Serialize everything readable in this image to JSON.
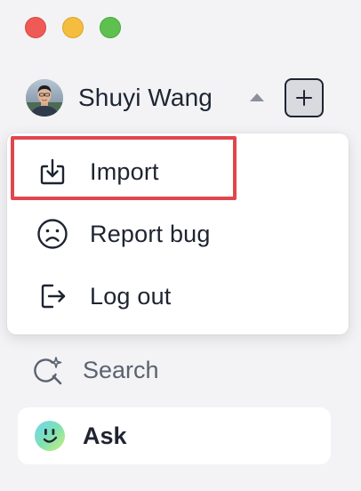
{
  "window": {
    "traffic_lights": [
      "close",
      "minimize",
      "zoom"
    ],
    "colors": {
      "close": "#ef5a57",
      "minimize": "#f4bd3d",
      "zoom": "#5ec14f"
    }
  },
  "user": {
    "name": "Shuyi Wang",
    "avatar_icon": "user-avatar",
    "toggle_icon": "caret-up-icon",
    "add_icon": "plus-icon"
  },
  "menu": {
    "items": [
      {
        "label": "Import",
        "icon": "import-icon",
        "highlighted": true
      },
      {
        "label": "Report bug",
        "icon": "frown-face-icon",
        "highlighted": false
      },
      {
        "label": "Log out",
        "icon": "logout-icon",
        "highlighted": false
      }
    ],
    "highlight_color": "#e0464e"
  },
  "nav": {
    "search": {
      "label": "Search",
      "icon": "search-sparkle-icon"
    },
    "ask": {
      "label": "Ask",
      "icon": "ask-assistant-icon"
    }
  }
}
